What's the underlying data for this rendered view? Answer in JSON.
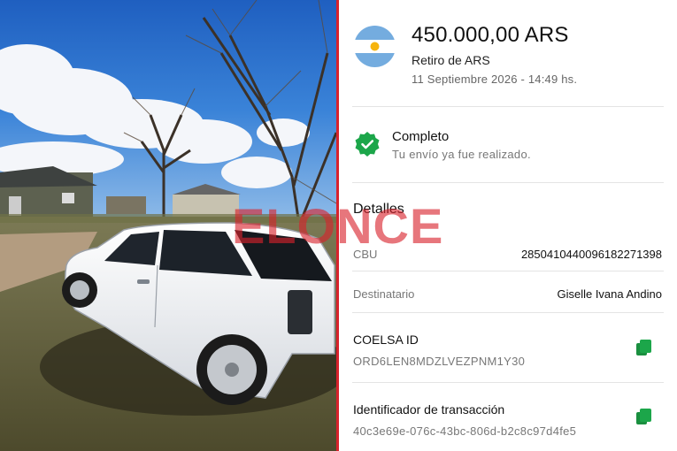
{
  "transfer": {
    "amount": "450.000,00 ARS",
    "type": "Retiro de ARS",
    "datetime": "11 Septiembre 2026 - 14:49 hs."
  },
  "status": {
    "title": "Completo",
    "description": "Tu envío ya fue realizado."
  },
  "details": {
    "title": "Detalles",
    "cbu_label": "CBU",
    "cbu_value": "2850410440096182271398",
    "recipient_label": "Destinatario",
    "recipient_value": "Giselle Ivana Andino",
    "coelsa_label": "COELSA ID",
    "coelsa_value": "ORD6LEN8MDZLVEZPNM1Y30",
    "txid_label": "Identificador de transacción",
    "txid_value": "40c3e69e-076c-43bc-806d-b2c8c97d4fe5"
  },
  "watermark": {
    "text": "ELONCE"
  },
  "icons": {
    "flag": "argentina-flag-icon",
    "status": "verified-check-icon",
    "copy": "copy-icon"
  },
  "colors": {
    "accent_green": "#1ca64a",
    "divider_red": "#d8222c",
    "flag_blue": "#74acdf",
    "flag_sun": "#f6b40e"
  }
}
